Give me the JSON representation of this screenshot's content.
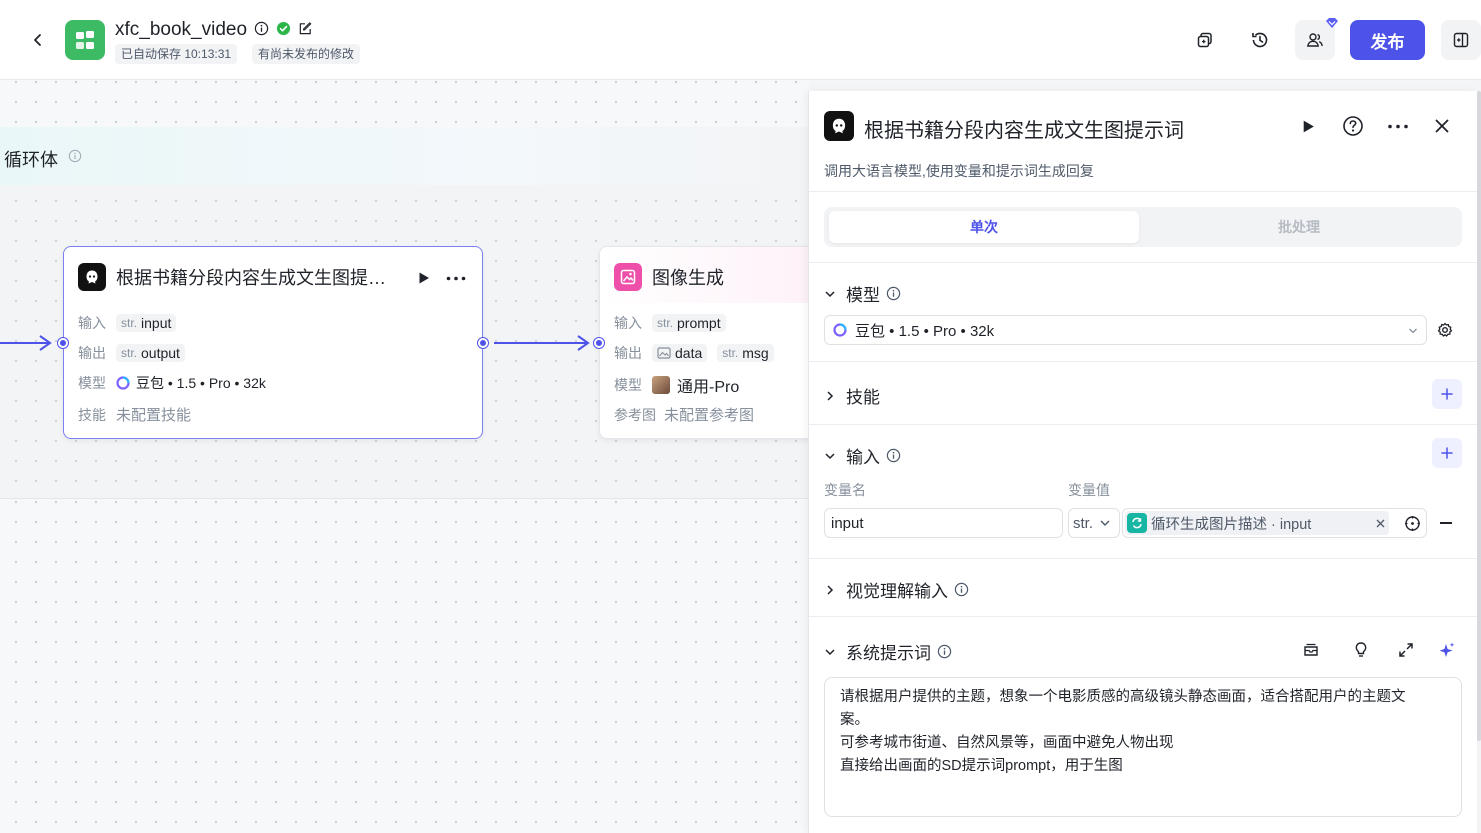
{
  "header": {
    "app_name": "xfc_book_video",
    "autosave": "已自动保存 10:13:31",
    "unpublished": "有尚未发布的修改",
    "publish_label": "发布"
  },
  "canvas": {
    "loop_title": "循环体",
    "llm_node": {
      "title": "根据书籍分段内容生成文生图提…",
      "input_label": "输入",
      "input_type": "str.",
      "input_var": "input",
      "output_label": "输出",
      "output_type": "str.",
      "output_var": "output",
      "model_label": "模型",
      "model_value": "豆包 • 1.5 • Pro • 32k",
      "skill_label": "技能",
      "skill_value": "未配置技能"
    },
    "image_node": {
      "title": "图像生成",
      "input_label": "输入",
      "input_type": "str.",
      "input_var": "prompt",
      "output_label": "输出",
      "output_var1": "data",
      "output_type2": "str.",
      "output_var2": "msg",
      "model_label": "模型",
      "model_value": "通用-Pro",
      "ref_label": "参考图",
      "ref_value": "未配置参考图"
    }
  },
  "panel": {
    "title": "根据书籍分段内容生成文生图提示词",
    "description": "调用大语言模型,使用变量和提示词生成回复",
    "tabs": [
      "单次",
      "批处理"
    ],
    "model_section": "模型",
    "model_value": "豆包 • 1.5 • Pro • 32k",
    "skills_section": "技能",
    "input_section": "输入",
    "var_name_label": "变量名",
    "var_value_label": "变量值",
    "var_name": "input",
    "var_type": "str.",
    "var_ref": "循环生成图片描述 · input",
    "vision_section": "视觉理解输入",
    "system_prompt_section": "系统提示词",
    "system_prompt_lines": [
      "请根据用户提供的主题，想象一个电影质感的高级镜头静态画面，适合搭配用户的主题文",
      "案。",
      "可参考城市街道、自然风景等，画面中避免人物出现",
      "直接给出画面的SD提示词prompt，用于生图"
    ]
  },
  "colors": {
    "accent": "#4d53e8",
    "app_logo": "#3dbb64",
    "success": "#2bb64a",
    "image_node_icon": "#ee4fa8"
  }
}
